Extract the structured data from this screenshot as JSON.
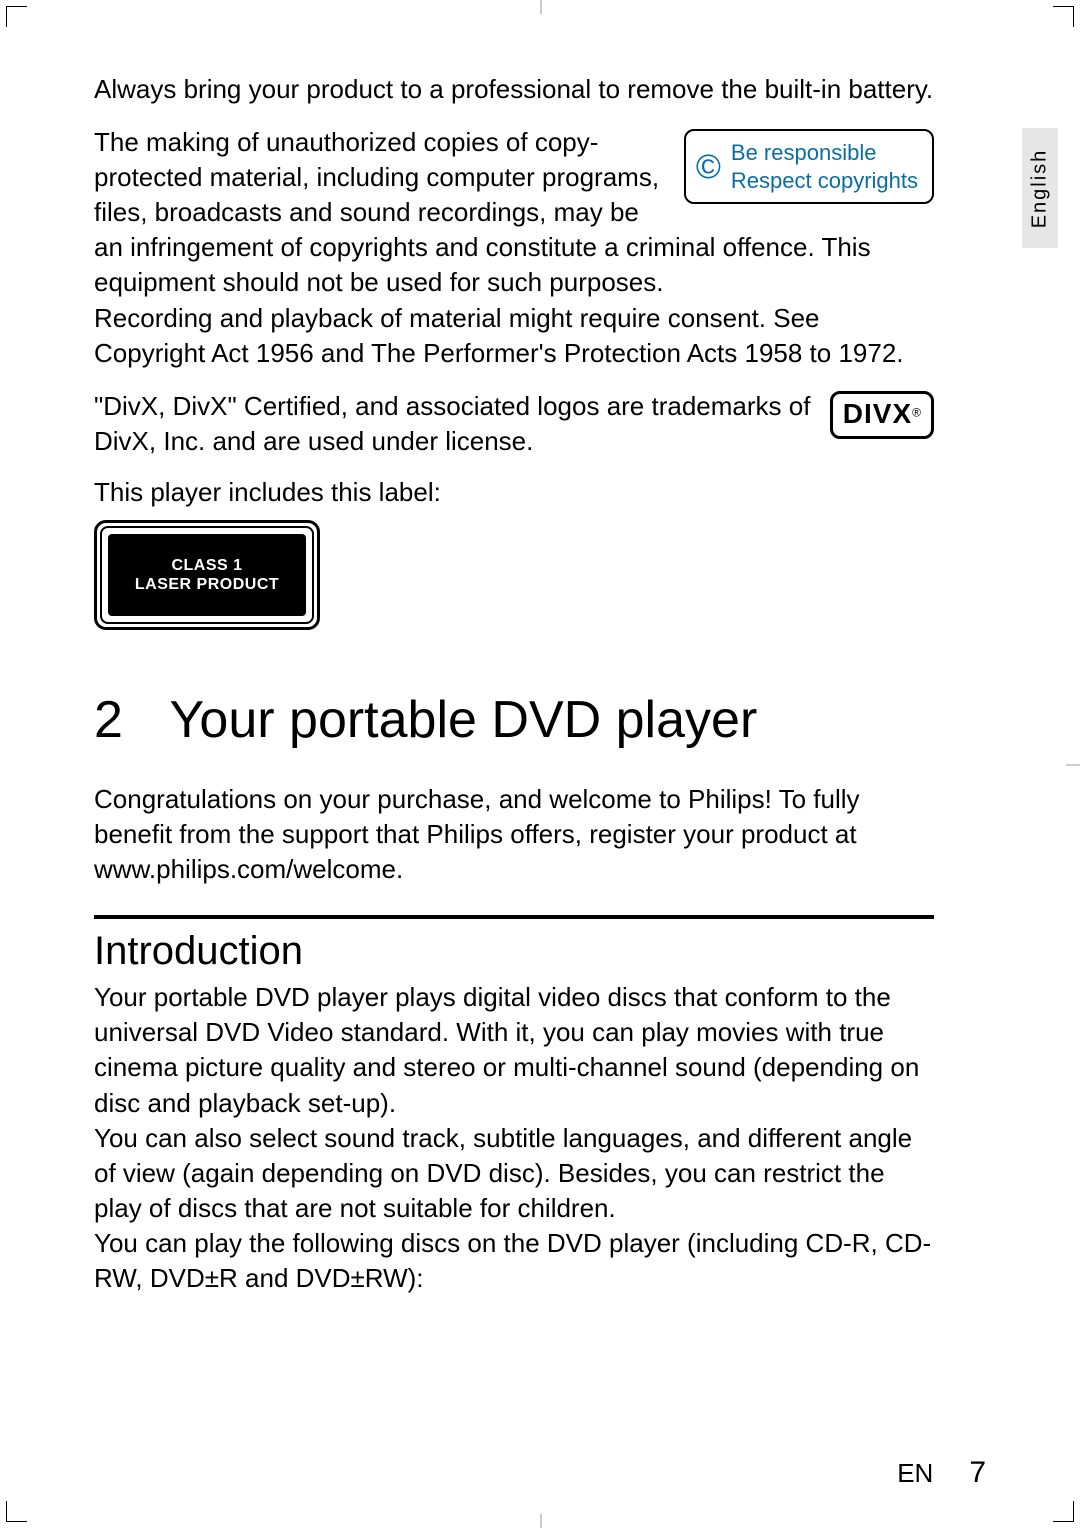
{
  "language_tab": "English",
  "battery_note": "Always bring your product to a professional to remove the built-in battery.",
  "copyright_box": {
    "line1": "Be responsible",
    "line2": "Respect copyrights"
  },
  "copyright_para": "The making of unauthorized copies of copy-protected material, including computer programs, files, broadcasts and sound recordings, may be an infringement of copyrights and constitute a criminal offence. This equipment should not be used for such purposes.",
  "recording_para": "Recording and playback of material might require consent. See Copyright Act 1956 and The Performer's Protection Acts 1958 to 1972.",
  "divx_para": "\"DivX, DivX\" Certified, and associated logos are trademarks of DivX, Inc. and are used under license.",
  "divx_logo": {
    "text": "DIVX",
    "reg": "®"
  },
  "label_heading": "This player includes this label:",
  "laser_label": {
    "line1": "CLASS 1",
    "line2": "LASER PRODUCT"
  },
  "chapter": {
    "number": "2",
    "title": "Your portable DVD player"
  },
  "congrats_para": "Congratulations on your purchase, and welcome to Philips! To fully benefit from the support that Philips offers, register your product at www.philips.com/welcome.",
  "section_title": "Introduction",
  "intro_p1": "Your portable DVD player plays digital video discs that conform to the universal DVD Video standard. With it, you can play movies with true cinema picture quality and stereo or multi-channel sound (depending on disc and playback set-up).",
  "intro_p2": "You can also select sound track, subtitle languages, and different angle of view (again depending on DVD disc). Besides, you can restrict the play of discs that are not suitable for children.",
  "intro_p3": "You can play the following discs on the DVD player (including CD-R, CD-RW, DVD±R and DVD±RW):",
  "footer": {
    "lang": "EN",
    "page": "7"
  }
}
